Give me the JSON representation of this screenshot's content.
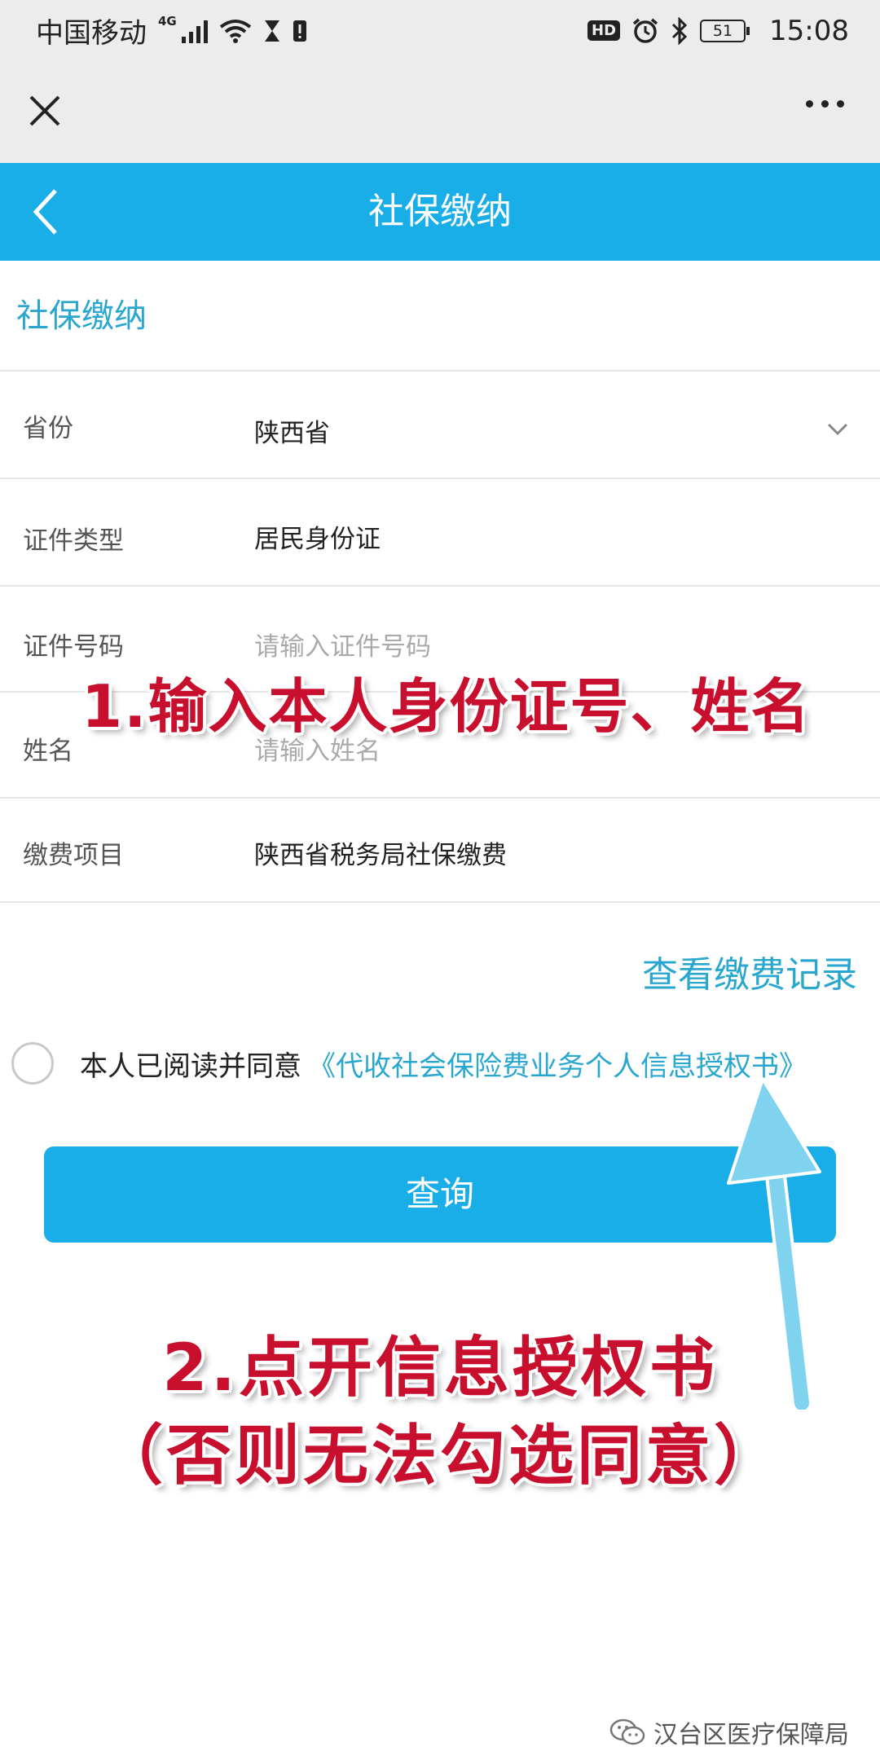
{
  "status_bar": {
    "carrier": "中国移动",
    "network": "4G",
    "battery": "51",
    "time": "15:08",
    "hd": "HD"
  },
  "header": {
    "title": "社保缴纳"
  },
  "section": {
    "title": "社保缴纳"
  },
  "form": {
    "province": {
      "label": "省份",
      "value": "陕西省"
    },
    "id_type": {
      "label": "证件类型",
      "value": "居民身份证"
    },
    "id_number": {
      "label": "证件号码",
      "placeholder": "请输入证件号码"
    },
    "name": {
      "label": "姓名",
      "placeholder": "请输入姓名"
    },
    "item": {
      "label": "缴费项目",
      "value": "陕西省税务局社保缴费"
    }
  },
  "record_link": "查看缴费记录",
  "agreement": {
    "text": "本人已阅读并同意",
    "link": "《代收社会保险费业务个人信息授权书》"
  },
  "query_button": "查询",
  "annotations": {
    "step1": "1.输入本人身份证号、姓名",
    "step2_line1": "2.点开信息授权书",
    "step2_line2": "（否则无法勾选同意）"
  },
  "footer": {
    "account": "汉台区医疗保障局"
  },
  "colors": {
    "accent": "#1aaee9",
    "link": "#2aa7cf",
    "annotation": "#c8102e"
  }
}
